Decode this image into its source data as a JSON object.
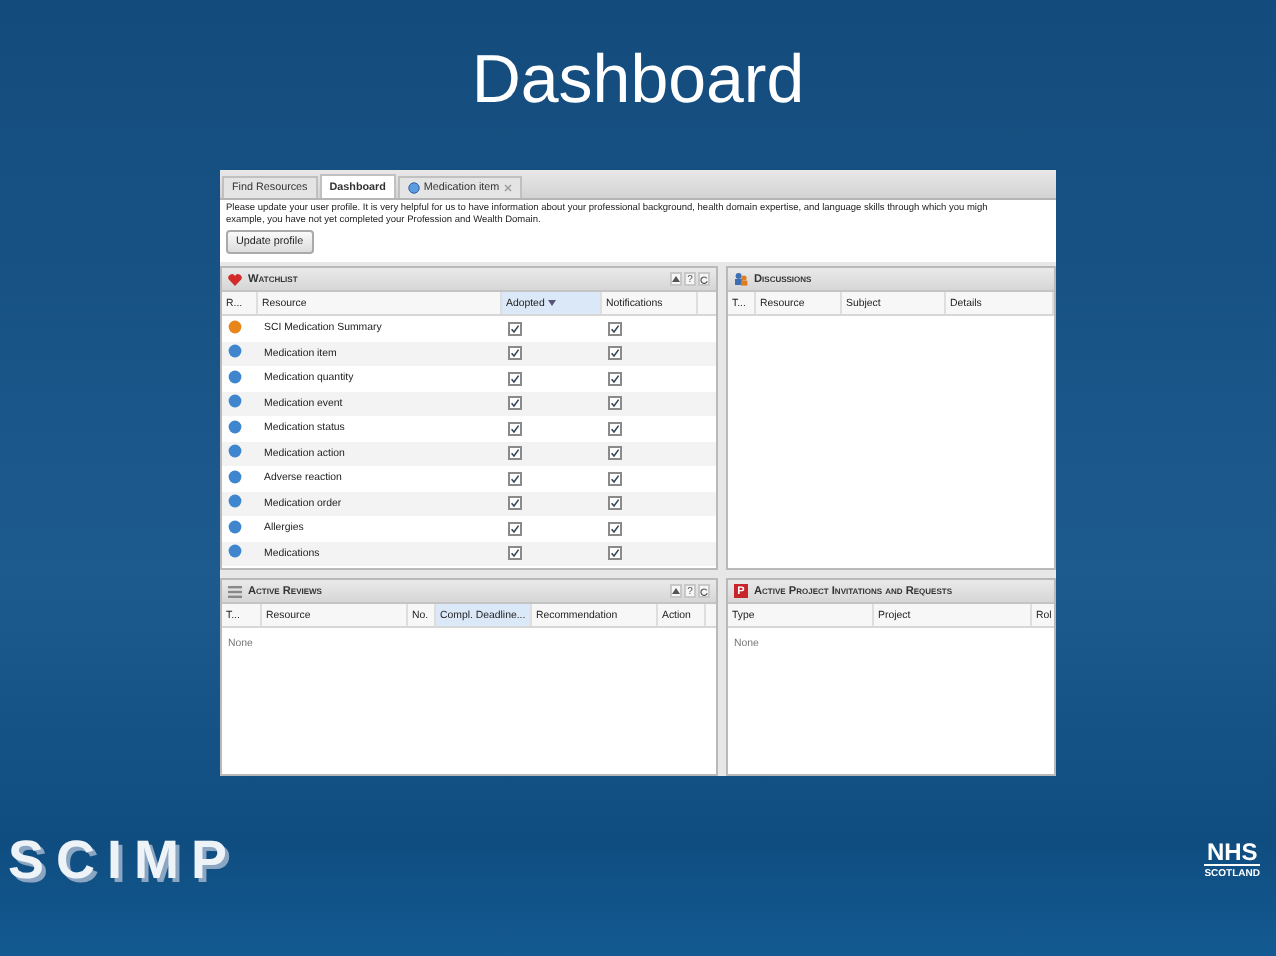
{
  "slide_title": "Dashboard",
  "tabs": [
    {
      "label": "Find Resources",
      "kind": "page",
      "selected": false
    },
    {
      "label": "Dashboard",
      "kind": "page",
      "selected": true
    },
    {
      "label": "Medication item",
      "kind": "resource",
      "selected": false
    }
  ],
  "profile_notice": {
    "lines": [
      "Please update your user profile. It is very helpful for us to have information about your professional background, health domain expertise, and language skills through which you migh",
      "example, you have not yet completed your Profession and Wealth Domain."
    ],
    "button": "Update profile"
  },
  "panels": [
    {
      "kind": "watchlist",
      "title": "Watchlist",
      "help": "?",
      "columns": [
        {
          "label": "R...",
          "sorted": false
        },
        {
          "label": "Resource",
          "sorted": false
        },
        {
          "label": "Adopted",
          "sorted": true
        },
        {
          "label": "Notifications",
          "sorted": false
        }
      ],
      "rows": [
        {
          "resource": "SCI Medication Summary",
          "color": "#e8861c",
          "adopted": true,
          "notifications": true
        },
        {
          "resource": "Medication item",
          "color": "#3f86cf",
          "adopted": true,
          "notifications": true
        },
        {
          "resource": "Medication quantity",
          "color": "#3f86cf",
          "adopted": true,
          "notifications": true
        },
        {
          "resource": "Medication event",
          "color": "#3f86cf",
          "adopted": true,
          "notifications": true
        },
        {
          "resource": "Medication status",
          "color": "#3f86cf",
          "adopted": true,
          "notifications": true
        },
        {
          "resource": "Medication action",
          "color": "#3f86cf",
          "adopted": true,
          "notifications": true
        },
        {
          "resource": "Adverse reaction",
          "color": "#3f86cf",
          "adopted": true,
          "notifications": true
        },
        {
          "resource": "Medication order",
          "color": "#3f86cf",
          "adopted": true,
          "notifications": true
        },
        {
          "resource": "Allergies",
          "color": "#3f86cf",
          "adopted": true,
          "notifications": true
        },
        {
          "resource": "Medications",
          "color": "#3f86cf",
          "adopted": true,
          "notifications": true
        }
      ]
    },
    {
      "kind": "discussions",
      "title": "Discussions",
      "columns": [
        {
          "label": "T...",
          "sorted": false
        },
        {
          "label": "Resource",
          "sorted": false
        },
        {
          "label": "Subject",
          "sorted": false
        },
        {
          "label": "Details",
          "sorted": false
        }
      ]
    },
    {
      "kind": "reviews",
      "title": "Active Reviews",
      "help": "?",
      "columns": [
        {
          "label": "T...",
          "sorted": false
        },
        {
          "label": "Resource",
          "sorted": false
        },
        {
          "label": "No.",
          "sorted": false
        },
        {
          "label": "Compl. Deadline...",
          "sorted": true
        },
        {
          "label": "Recommendation",
          "sorted": false
        },
        {
          "label": "Action",
          "sorted": false
        }
      ],
      "empty": "None"
    },
    {
      "kind": "invitations",
      "title": "Active Project Invitations and Requests",
      "icon_letter": "P",
      "columns": [
        {
          "label": "Type",
          "sorted": false
        },
        {
          "label": "Project",
          "sorted": false
        },
        {
          "label": "Rol",
          "sorted": false
        }
      ],
      "empty": "None"
    }
  ],
  "logos": {
    "scimp": "SCIMP",
    "nhs": "NHS",
    "nhs_sub": "SCOTLAND"
  }
}
